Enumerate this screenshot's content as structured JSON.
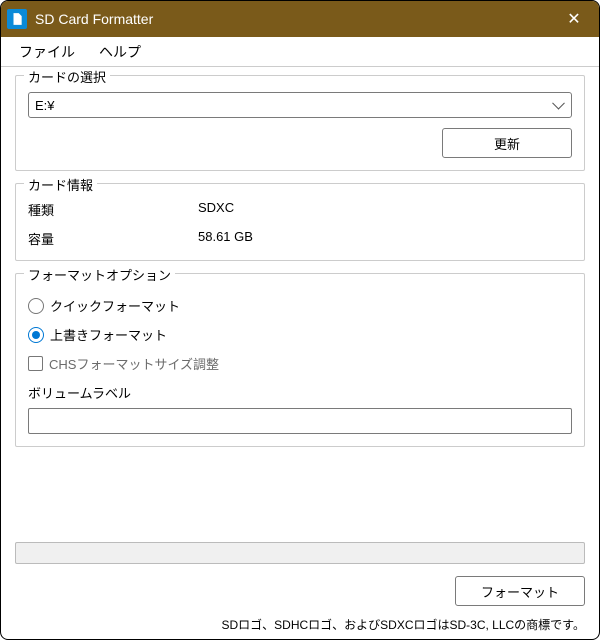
{
  "window": {
    "title": "SD Card Formatter"
  },
  "menu": {
    "file": "ファイル",
    "help": "ヘルプ"
  },
  "card_select": {
    "group_label": "カードの選択",
    "selected_drive": "E:¥",
    "refresh_label": "更新"
  },
  "card_info": {
    "group_label": "カード情報",
    "type_label": "種類",
    "type_value": "SDXC",
    "capacity_label": "容量",
    "capacity_value": "58.61 GB"
  },
  "format_options": {
    "group_label": "フォーマットオプション",
    "quick_label": "クイックフォーマット",
    "overwrite_label": "上書きフォーマット",
    "chs_label": "CHSフォーマットサイズ調整",
    "volume_label_caption": "ボリュームラベル",
    "volume_label_value": ""
  },
  "actions": {
    "format_button": "フォーマット"
  },
  "footer": {
    "text": "SDロゴ、SDHCロゴ、およびSDXCロゴはSD-3C, LLCの商標です。"
  }
}
